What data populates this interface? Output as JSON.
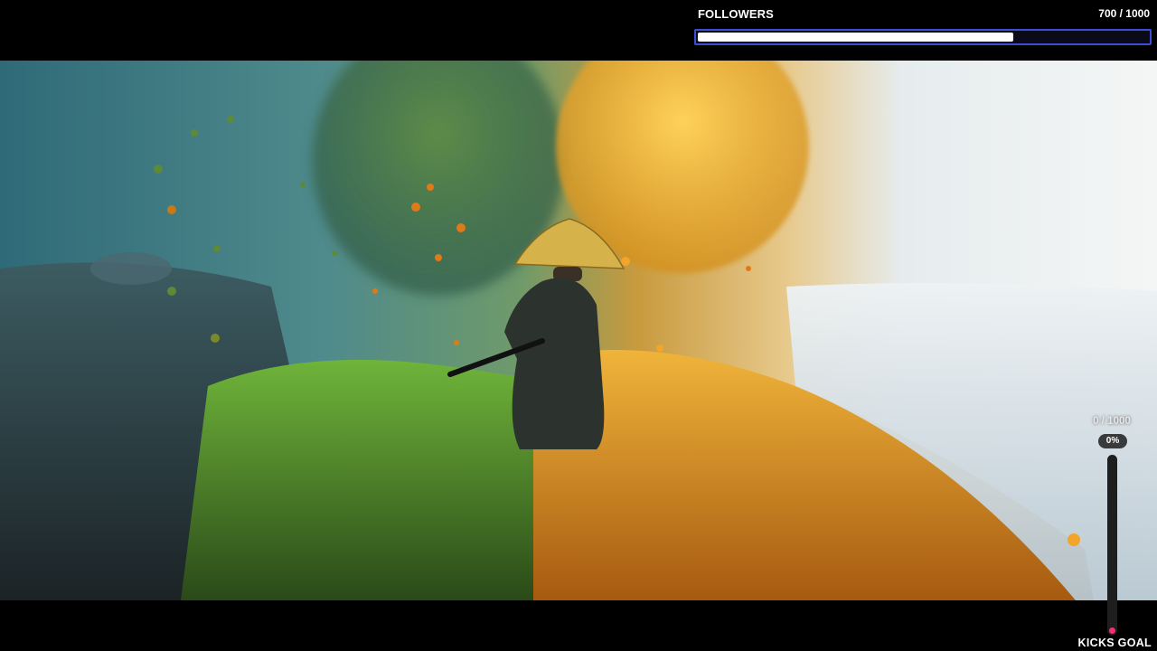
{
  "followers": {
    "title": "FOLLOWERS",
    "count_label": "700 / 1000",
    "current": 700,
    "goal": 1000,
    "progress_fraction": 0.7,
    "bar_border_color": "#3b4fd6",
    "bar_fill_color": "#ffffff"
  },
  "kicks": {
    "count_label": "0 / 1000",
    "percent_label": "0%",
    "current": 0,
    "goal": 1000,
    "progress_fraction": 0,
    "label": "KICKS GOAL",
    "dot_color": "#ff2d6f"
  },
  "scene": {
    "subject": "samurai-figure",
    "colors": {
      "left_mist": "#3f7f8a",
      "grass": "#4f8f24",
      "autumn": "#e39a1a",
      "fog": "#dfe6ea"
    }
  }
}
